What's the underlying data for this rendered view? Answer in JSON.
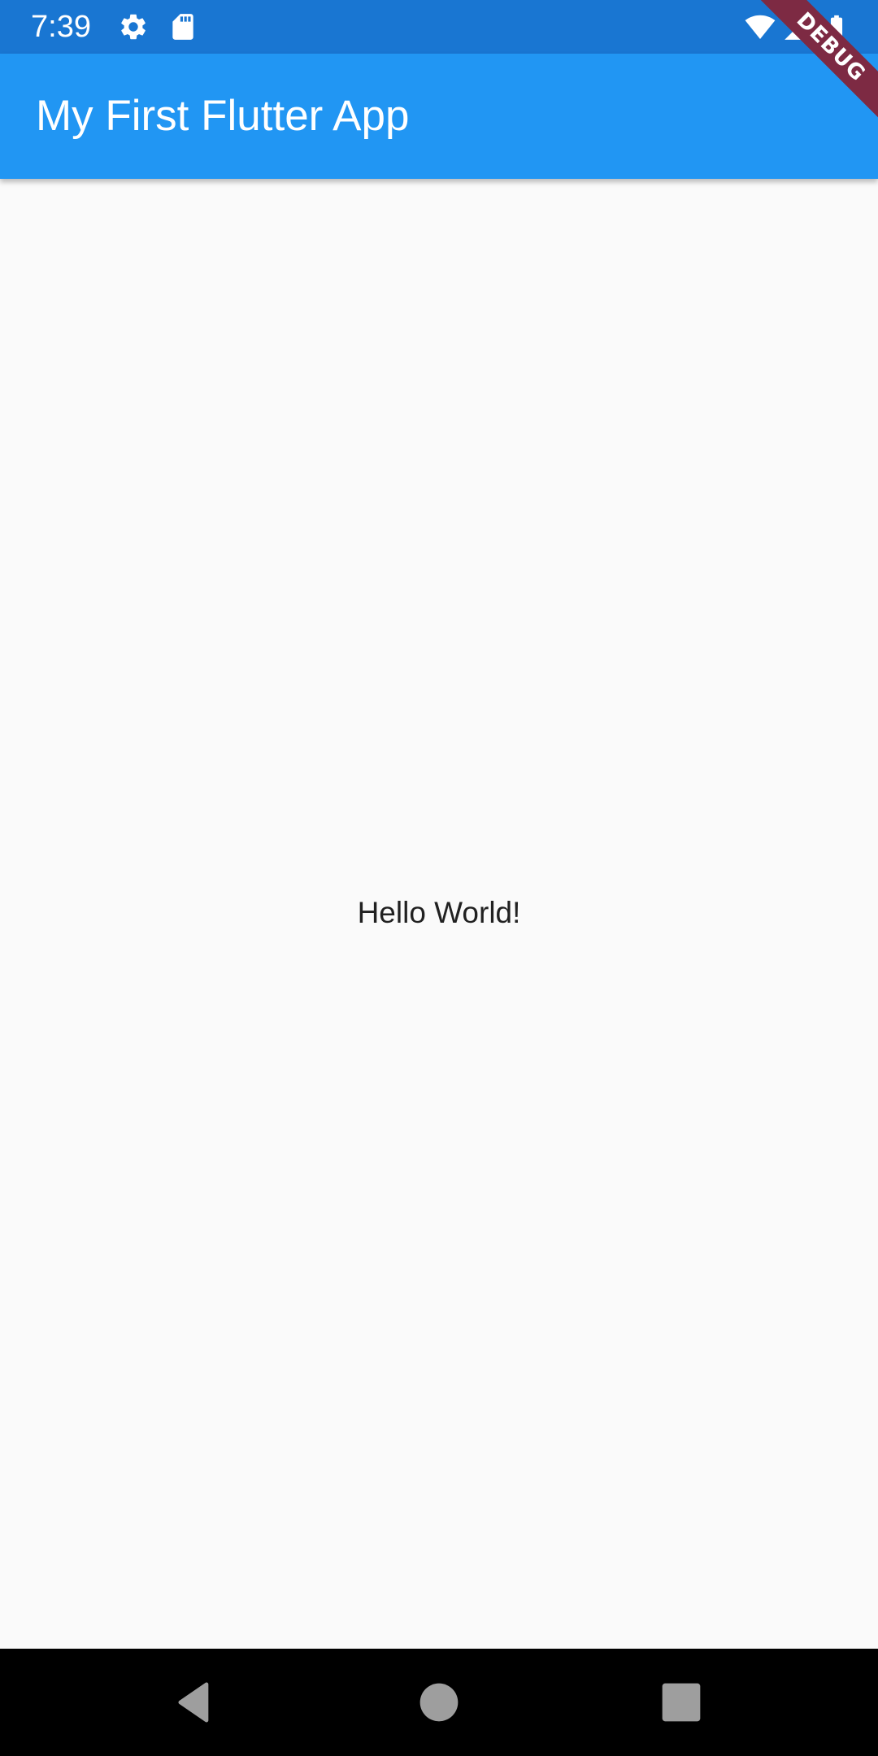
{
  "status_bar": {
    "time": "7:39",
    "icons_left": [
      "gear-icon",
      "sd-card-icon"
    ],
    "icons_right": [
      "wifi-icon",
      "signal-icon",
      "battery-icon"
    ],
    "background": "#1976d2"
  },
  "app_bar": {
    "title": "My First Flutter App",
    "background": "#2196f3"
  },
  "body": {
    "text": "Hello World!",
    "background": "#fafafa"
  },
  "debug_banner": {
    "label": "DEBUG",
    "color": "#7d2a43"
  },
  "nav_bar": {
    "buttons": [
      "back-icon",
      "home-icon",
      "recents-icon"
    ],
    "background": "#000000"
  }
}
